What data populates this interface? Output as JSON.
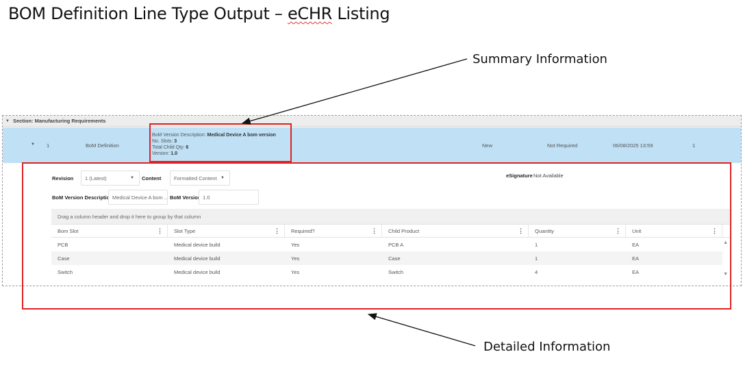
{
  "slide": {
    "title_prefix": "BOM Definition Line Type Output – ",
    "title_emph": "eCHR",
    "title_suffix": " Listing"
  },
  "callouts": {
    "summary": "Summary Information",
    "detailed": "Detailed Information"
  },
  "section": {
    "label": "Section: Manufacturing Requirements"
  },
  "summary_row": {
    "index": "1",
    "type": "BoM Definition",
    "desc_label": "BoM Version Description: ",
    "desc_value": "Medical Device A bom version",
    "slots_label": "No. Slots: ",
    "slots_value": "3",
    "child_qty_label": "Total Child Qty: ",
    "child_qty_value": "6",
    "version_label": "Version: ",
    "version_value": "1.0",
    "status": "New",
    "signature_req": "Not Required",
    "timestamp": "06/08/2025 13:59",
    "count": "1"
  },
  "detail": {
    "revision_label": "Revision",
    "revision_value": "1 (Latest)",
    "content_label": "Content",
    "content_value": "Formatted Content",
    "esig_label": "eSignature",
    "esig_value": "Not Available",
    "bom_desc_label": "BoM Version Description",
    "bom_desc_value": "Medical Device A bom ...",
    "bom_version_label": "BoM Version",
    "bom_version_value": "1.0"
  },
  "grid": {
    "group_hint": "Drag a column header and drop it here to group by that column",
    "columns": [
      "Bom Slot",
      "Slot Type",
      "Required?",
      "Child Product",
      "Quantity",
      "Unit"
    ],
    "rows": [
      [
        "PCB",
        "Medical device build",
        "Yes",
        "PCB A",
        "1",
        "EA"
      ],
      [
        "Case",
        "Medical device build",
        "Yes",
        "Case",
        "1",
        "EA"
      ],
      [
        "Switch",
        "Medical device build",
        "Yes",
        "Switch",
        "4",
        "EA"
      ]
    ]
  },
  "icons": {
    "menu": "⋮",
    "dropdown": "▼",
    "collapse": "▼",
    "scroll_up": "▲",
    "scroll_down": "▼"
  },
  "colors": {
    "highlight_row": "#bfe0f5",
    "callout_box": "#e02020",
    "section_header": "#ededed"
  }
}
